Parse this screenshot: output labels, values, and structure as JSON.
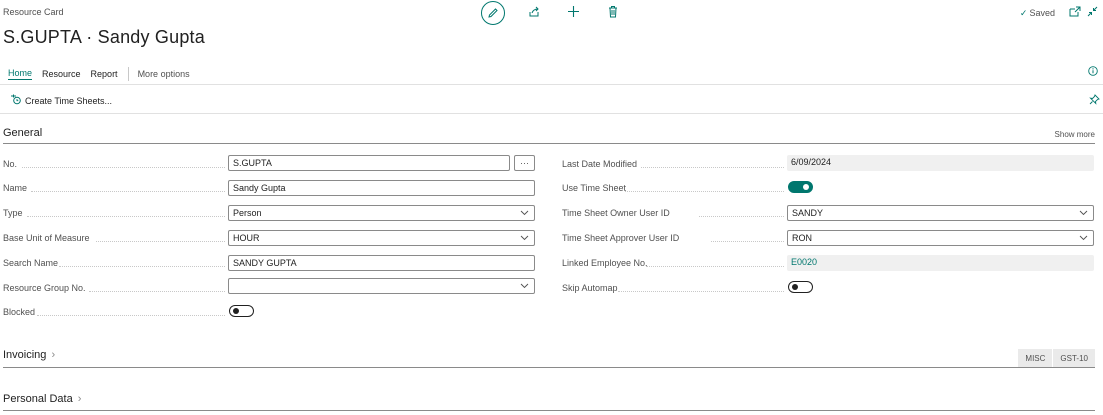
{
  "header": {
    "caption": "Resource Card",
    "title": "S.GUPTA · Sandy Gupta",
    "saved_label": "Saved"
  },
  "icons": {
    "edit": "pencil-icon",
    "share": "share-icon",
    "add": "plus-icon",
    "delete": "trash-icon",
    "saved_check": "checkmark-icon",
    "open_new": "open-new-window-icon",
    "collapse": "collapse-icon",
    "info": "info-icon",
    "pin": "pin-icon",
    "time_sheet": "time-sheet-icon"
  },
  "tabs": [
    "Home",
    "Resource",
    "Report"
  ],
  "more_options": "More options",
  "action_bar": {
    "create_time_sheets": "Create Time Sheets..."
  },
  "general": {
    "title": "General",
    "show_more": "Show more",
    "left_fields": {
      "no": {
        "label": "No.",
        "value": "S.GUPTA",
        "assist": "···"
      },
      "name": {
        "label": "Name",
        "value": "Sandy Gupta"
      },
      "type": {
        "label": "Type",
        "value": "Person"
      },
      "base_unit": {
        "label": "Base Unit of Measure",
        "value": "HOUR"
      },
      "search_name": {
        "label": "Search Name",
        "value": "SANDY GUPTA"
      },
      "resource_group": {
        "label": "Resource Group No.",
        "value": ""
      },
      "blocked": {
        "label": "Blocked",
        "value": false
      }
    },
    "right_fields": {
      "last_modified": {
        "label": "Last Date Modified",
        "value": "6/09/2024"
      },
      "use_time_sheet": {
        "label": "Use Time Sheet",
        "value": true
      },
      "owner_user": {
        "label": "Time Sheet Owner User ID",
        "value": "SANDY"
      },
      "approver_user": {
        "label": "Time Sheet Approver User ID",
        "value": "RON"
      },
      "linked_employee": {
        "label": "Linked Employee No.",
        "value": "E0020"
      },
      "skip_automap": {
        "label": "Skip Automap",
        "value": false
      }
    }
  },
  "invoicing": {
    "title": "Invoicing",
    "badges": [
      "MISC",
      "GST-10"
    ]
  },
  "personal_data": {
    "title": "Personal Data"
  },
  "colors": {
    "accent": "#00776e",
    "text": "#212121",
    "muted": "#505050"
  }
}
